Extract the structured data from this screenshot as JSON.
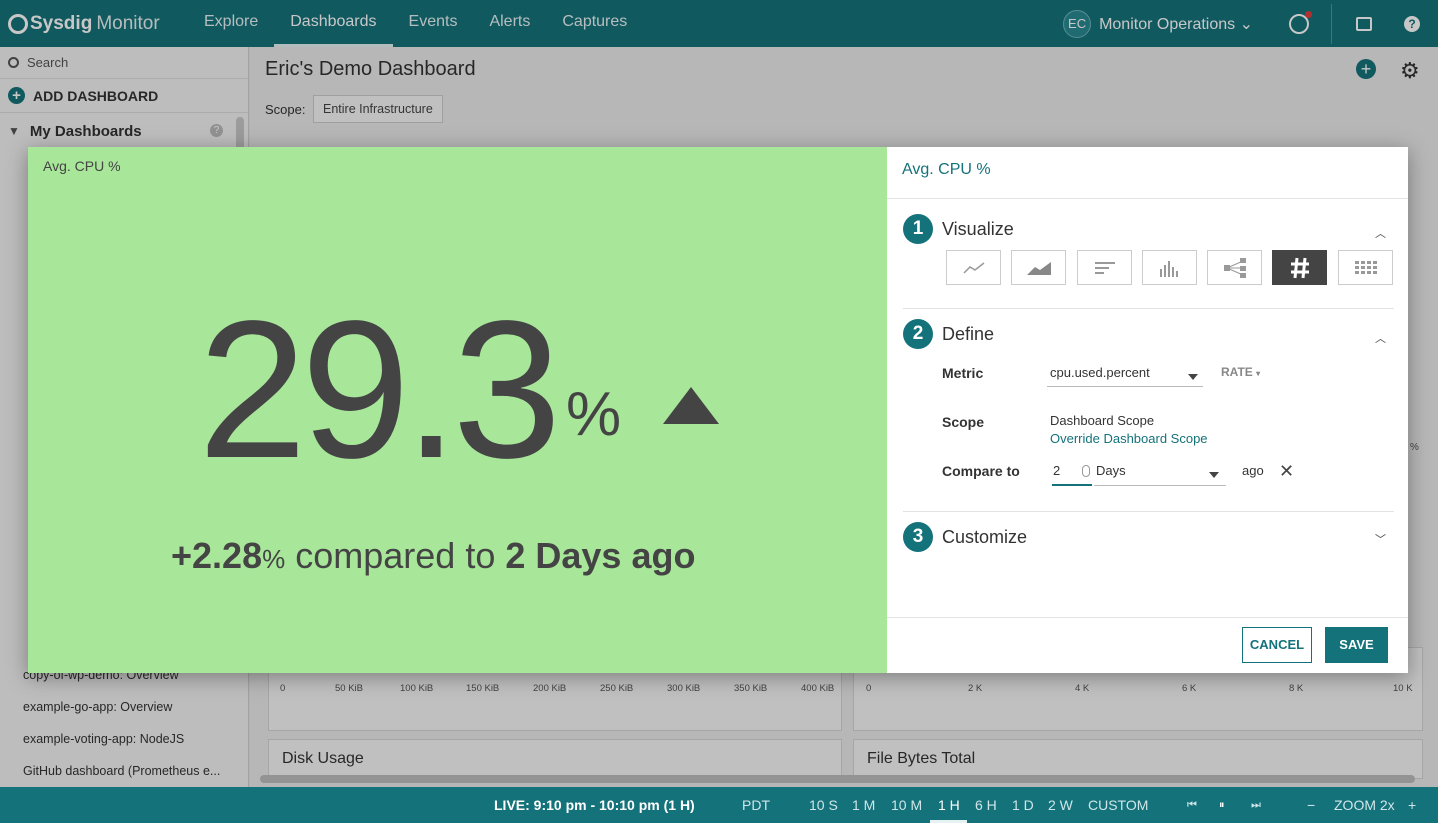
{
  "app": {
    "logo_brand": "Sysdig",
    "logo_product": "Monitor",
    "nav": [
      "Explore",
      "Dashboards",
      "Events",
      "Alerts",
      "Captures"
    ],
    "active_nav": "Dashboards",
    "avatar_initials": "EC",
    "team": "Monitor Operations"
  },
  "sidebar": {
    "search_placeholder": "Search",
    "add_dashboard": "ADD DASHBOARD",
    "my_dashboards": "My Dashboards",
    "visible_items": [
      "copy-of-wp-demo: Overview",
      "example-go-app: Overview",
      "example-voting-app: NodeJS",
      "GitHub dashboard (Prometheus e..."
    ]
  },
  "dashboard": {
    "title": "Eric's Demo Dashboard",
    "scope_label": "Scope:",
    "scope_value": "Entire Infrastructure",
    "left_axis_ticks": [
      "0",
      "50 KiB",
      "100 KiB",
      "150 KiB",
      "200 KiB",
      "250 KiB",
      "300 KiB",
      "350 KiB",
      "400 KiB"
    ],
    "right_axis_ticks": [
      "0",
      "2 K",
      "4 K",
      "6 K",
      "8 K",
      "10 K"
    ],
    "card_disk_usage": "Disk Usage",
    "card_file_bytes": "File Bytes Total",
    "partial_pct": "%"
  },
  "preview": {
    "title": "Avg. CPU %",
    "value": "29.3",
    "unit": "%",
    "delta": "+2.28",
    "delta_unit": "%",
    "compare_text": "compared to",
    "compare_period": "2 Days ago"
  },
  "config": {
    "title": "Avg. CPU %",
    "step1_num": "1",
    "step1_title": "Visualize",
    "step2_num": "2",
    "step2_title": "Define",
    "step3_num": "3",
    "step3_title": "Customize",
    "metric_label": "Metric",
    "metric_value": "cpu.used.percent",
    "rate_label": "RATE",
    "scope_label": "Scope",
    "scope_value": "Dashboard Scope",
    "override_link": "Override Dashboard Scope",
    "compare_label": "Compare to",
    "compare_amount": "2",
    "compare_unit": "Days",
    "compare_suffix": "ago",
    "cancel": "CANCEL",
    "save": "SAVE",
    "viz_types": [
      "line-chart-icon",
      "area-chart-icon",
      "toplist-icon",
      "histogram-icon",
      "topology-icon",
      "number-icon",
      "table-icon"
    ],
    "active_viz": "number-icon"
  },
  "timebar": {
    "live": "LIVE: 9:10 pm - 10:10 pm (1 H)",
    "timezone": "PDT",
    "ranges": [
      "10 S",
      "1 M",
      "10 M",
      "1 H",
      "6 H",
      "1 D",
      "2 W",
      "CUSTOM"
    ],
    "active_range": "1 H",
    "zoom": "ZOOM 2x",
    "zoom_out": "−",
    "zoom_in": "+"
  },
  "colors": {
    "brand": "#14727a",
    "preview_bg": "#a8e69a",
    "alert_red": "#e63c3c"
  }
}
